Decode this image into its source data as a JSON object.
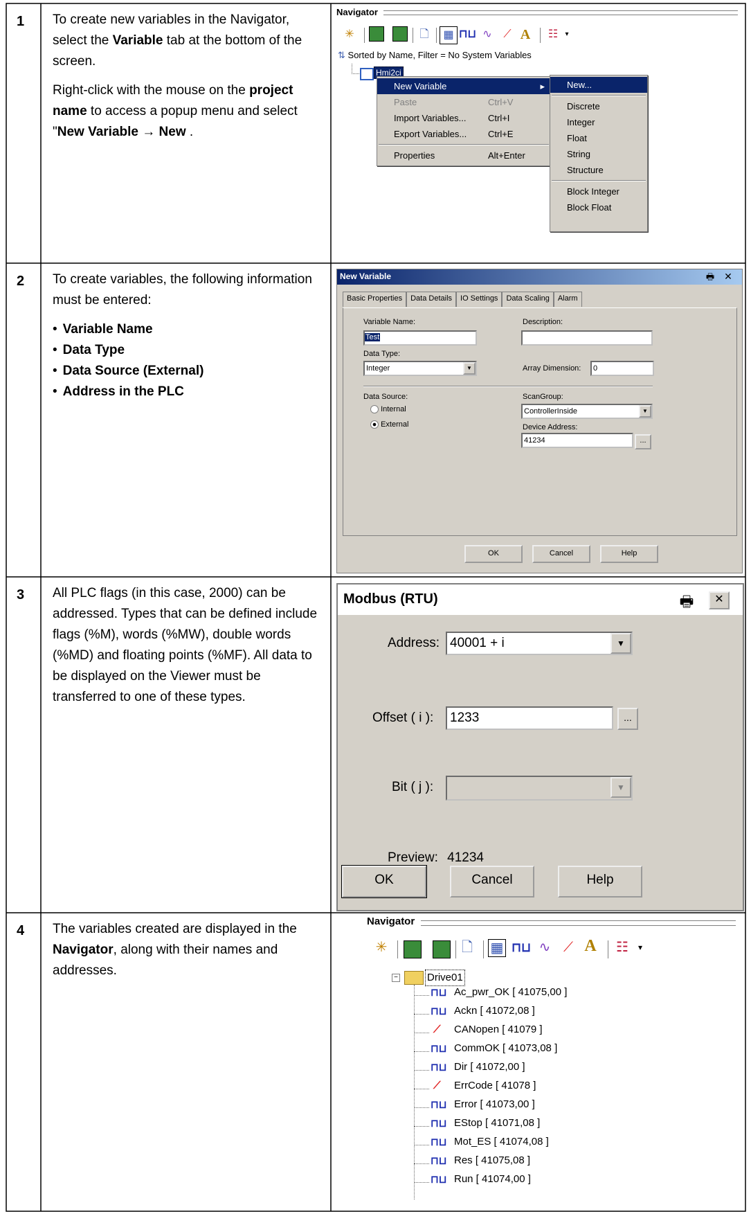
{
  "rows": [
    {
      "num": "1",
      "p1_a": "To create new variables in the Navigator, select the ",
      "p1_b": "Variable",
      "p1_c": " tab at the bottom of the screen.",
      "p2_a": "Right-click with the mouse on the ",
      "p2_b": "project name",
      "p2_c": " to access a popup menu and select \"",
      "p2_d": "New Variable → New",
      "p2_e": " ."
    },
    {
      "num": "2",
      "p1": "To create variables, the following information must be entered:",
      "bullets": [
        "Variable Name",
        "Data Type",
        "Data Source (External)",
        "Address in the PLC"
      ]
    },
    {
      "num": "3",
      "p1": "All PLC flags (in this case, 2000) can be addressed. Types that can be defined include flags (%M), words (%MW), double words (%MD) and floating points (%MF). All data to be displayed on the Viewer must be transferred to one of these types."
    },
    {
      "num": "4",
      "p1_a": "The variables created are displayed in the ",
      "p1_b": "Navigator",
      "p1_c": ", along with their names and addresses."
    }
  ],
  "shot1": {
    "title": "Navigator",
    "sort_label": "Sorted by Name, Filter = No System Variables",
    "project": "Hmi2ci",
    "menu": [
      {
        "label": "New Variable",
        "shortcut": "",
        "state": "selected"
      },
      {
        "label": "Paste",
        "shortcut": "Ctrl+V",
        "state": "disabled"
      },
      {
        "label": "Import Variables...",
        "shortcut": "Ctrl+I",
        "state": "normal"
      },
      {
        "label": "Export Variables...",
        "shortcut": "Ctrl+E",
        "state": "normal"
      },
      {
        "label": "Properties",
        "shortcut": "Alt+Enter",
        "state": "normal"
      }
    ],
    "submenu": [
      "New...",
      "Discrete",
      "Integer",
      "Float",
      "String",
      "Structure",
      "Block Integer",
      "Block Float"
    ]
  },
  "shot2": {
    "title": "New Variable",
    "tabs": [
      "Basic Properties",
      "Data Details",
      "IO Settings",
      "Data Scaling",
      "Alarm"
    ],
    "var_name_label": "Variable Name:",
    "var_name_value": "Test",
    "desc_label": "Description:",
    "data_type_label": "Data Type:",
    "data_type_value": "Integer",
    "array_label": "Array Dimension:",
    "array_value": "0",
    "data_source_label": "Data Source:",
    "internal_label": "Internal",
    "external_label": "External",
    "scan_label": "ScanGroup:",
    "scan_value": "ControllerInside",
    "device_label": "Device Address:",
    "device_value": "41234",
    "browse": "...",
    "ok": "OK",
    "cancel": "Cancel",
    "help": "Help"
  },
  "shot3": {
    "title": "Modbus (RTU)",
    "address_label": "Address:",
    "address_value": "40001 + i",
    "offset_label": "Offset ( i ):",
    "offset_value": "1233",
    "bit_label": "Bit ( j ):",
    "preview_label": "Preview:",
    "preview_value": "41234",
    "browse": "...",
    "ok": "OK",
    "cancel": "Cancel",
    "help": "Help"
  },
  "shot4": {
    "title": "Navigator",
    "folder": "Drive01",
    "items": [
      {
        "name": "Ac_pwr_OK [ 41075,00 ]",
        "icon": "discrete-icon"
      },
      {
        "name": "Ackn [ 41072,08 ]",
        "icon": "discrete-icon"
      },
      {
        "name": "CANopen [ 41079 ]",
        "icon": "integer-icon"
      },
      {
        "name": "CommOK [ 41073,08 ]",
        "icon": "discrete-icon"
      },
      {
        "name": "Dir [ 41072,00 ]",
        "icon": "discrete-icon"
      },
      {
        "name": "ErrCode [ 41078 ]",
        "icon": "integer-icon"
      },
      {
        "name": "Error [ 41073,00 ]",
        "icon": "discrete-icon"
      },
      {
        "name": "EStop [ 41071,08 ]",
        "icon": "discrete-icon"
      },
      {
        "name": "Mot_ES [ 41074,08 ]",
        "icon": "discrete-icon"
      },
      {
        "name": "Res [ 41075,08 ]",
        "icon": "discrete-icon"
      },
      {
        "name": "Run [ 41074,00 ]",
        "icon": "discrete-icon"
      }
    ]
  }
}
